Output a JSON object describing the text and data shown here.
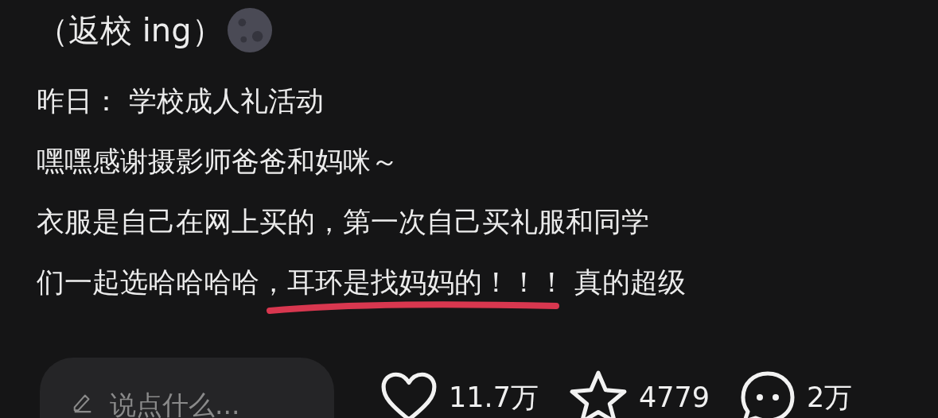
{
  "header": {
    "title": "（返校 ing）"
  },
  "post": {
    "lines": [
      [
        {
          "text": "昨日：  学校成人礼活动"
        }
      ],
      [
        {
          "text": "嘿嘿感谢摄影师爸爸和妈咪～"
        }
      ],
      [
        {
          "text": "衣服是自己在网上买的，第一次自己买礼服和同学"
        }
      ],
      [
        {
          "text": "们一起选哈哈哈哈，"
        },
        {
          "text": "耳环是找妈妈的！！！",
          "underlined": true
        },
        {
          "text": " 真的超级"
        }
      ]
    ]
  },
  "comment_box": {
    "placeholder": "说点什么..."
  },
  "stats": [
    {
      "kind": "like",
      "count": "11.7万"
    },
    {
      "kind": "favorite",
      "count": "4779"
    },
    {
      "kind": "comment",
      "count": "2万"
    }
  ]
}
